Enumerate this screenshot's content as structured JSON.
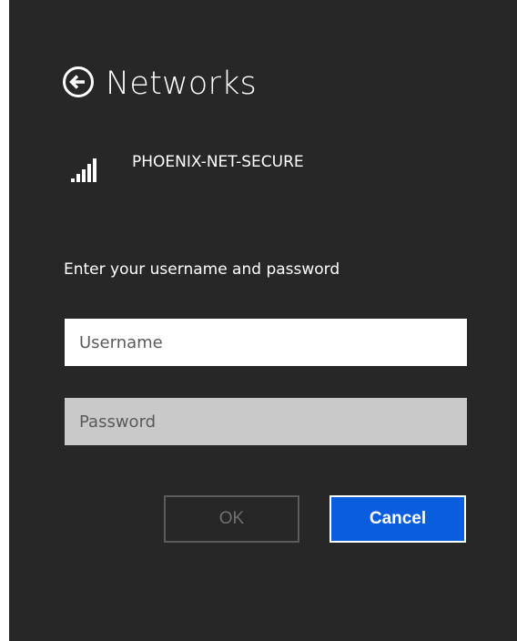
{
  "header": {
    "title": "Networks",
    "back_icon": "back-arrow-circle-icon"
  },
  "network": {
    "name": "PHOENIX-NET-SECURE",
    "signal_icon": "wifi-signal-bars-icon",
    "signal_bars": 5
  },
  "form": {
    "prompt": "Enter your username and password",
    "username_placeholder": "Username",
    "password_placeholder": "Password"
  },
  "buttons": {
    "ok_label": "OK",
    "cancel_label": "Cancel"
  },
  "colors": {
    "panel_bg": "#272727",
    "accent": "#0a5dde",
    "text": "#ffffff",
    "disabled_text": "#707070"
  }
}
